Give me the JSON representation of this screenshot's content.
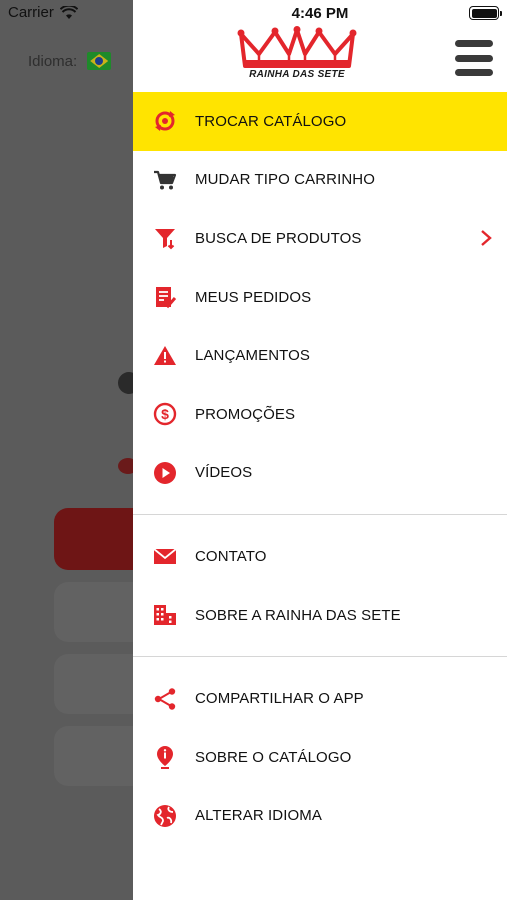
{
  "status_bar": {
    "carrier": "Carrier",
    "time": "4:46 PM"
  },
  "background": {
    "language_label": "Idioma:"
  },
  "brand": {
    "name": "RAINHA DAS SETE",
    "accent": "#e3262c",
    "highlight": "#ffe400"
  },
  "menu": {
    "group1": [
      {
        "label": "TROCAR CATÁLOGO",
        "icon": "swap-catalog-icon",
        "active": true
      },
      {
        "label": "MUDAR TIPO CARRINHO",
        "icon": "cart-icon"
      },
      {
        "label": "BUSCA DE PRODUTOS",
        "icon": "filter-icon",
        "has_submenu": true
      },
      {
        "label": "MEUS PEDIDOS",
        "icon": "orders-icon"
      },
      {
        "label": "LANÇAMENTOS",
        "icon": "warning-icon"
      },
      {
        "label": "PROMOÇÕES",
        "icon": "dollar-icon"
      },
      {
        "label": "VÍDEOS",
        "icon": "play-icon"
      }
    ],
    "group2": [
      {
        "label": "CONTATO",
        "icon": "mail-icon"
      },
      {
        "label": "SOBRE A RAINHA DAS SETE",
        "icon": "building-icon"
      }
    ],
    "group3": [
      {
        "label": "COMPARTILHAR O APP",
        "icon": "share-icon"
      },
      {
        "label": "SOBRE O CATÁLOGO",
        "icon": "info-pin-icon"
      },
      {
        "label": "ALTERAR IDIOMA",
        "icon": "globe-icon"
      }
    ]
  }
}
